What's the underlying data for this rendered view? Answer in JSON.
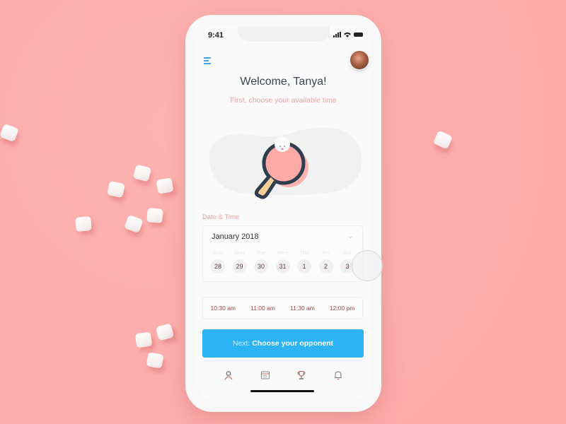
{
  "status_bar": {
    "time": "9:41"
  },
  "header": {
    "menu_icon": "hamburger-menu-icon",
    "avatar": "user-avatar",
    "title": "Welcome, Tanya!",
    "subtitle": "First, choose your available time"
  },
  "illustration": "ping-pong-paddle-with-ball",
  "date_time": {
    "label": "Date & Time",
    "month": "January 2018",
    "days": [
      {
        "name": "Sun",
        "date": "28"
      },
      {
        "name": "Mon",
        "date": "29"
      },
      {
        "name": "Tue",
        "date": "30"
      },
      {
        "name": "Wed",
        "date": "31"
      },
      {
        "name": "Thu",
        "date": "1"
      },
      {
        "name": "Fri",
        "date": "2"
      },
      {
        "name": "Sat",
        "date": "3"
      }
    ],
    "times": [
      "10:30 am",
      "11:00 am",
      "11:30 am",
      "12:00 pm"
    ]
  },
  "next_button": {
    "prefix": "Next:",
    "label": "Choose your opponent"
  },
  "tabbar": [
    "profile-icon",
    "calendar-icon",
    "trophy-icon",
    "bell-icon"
  ],
  "colors": {
    "accent": "#2cb3f5",
    "background": "#fdaeac",
    "subtitle": "#e9a2a5"
  }
}
